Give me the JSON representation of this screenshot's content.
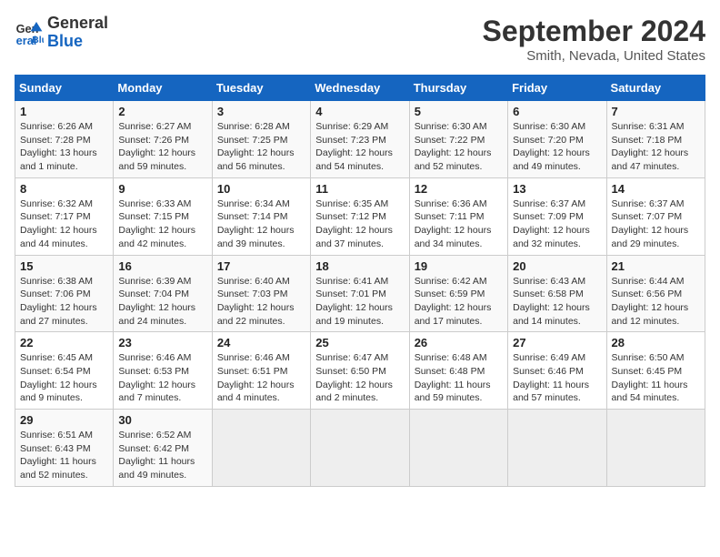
{
  "logo": {
    "line1": "General",
    "line2": "Blue"
  },
  "title": "September 2024",
  "subtitle": "Smith, Nevada, United States",
  "weekdays": [
    "Sunday",
    "Monday",
    "Tuesday",
    "Wednesday",
    "Thursday",
    "Friday",
    "Saturday"
  ],
  "weeks": [
    [
      {
        "day": "1",
        "info": "Sunrise: 6:26 AM\nSunset: 7:28 PM\nDaylight: 13 hours\nand 1 minute."
      },
      {
        "day": "2",
        "info": "Sunrise: 6:27 AM\nSunset: 7:26 PM\nDaylight: 12 hours\nand 59 minutes."
      },
      {
        "day": "3",
        "info": "Sunrise: 6:28 AM\nSunset: 7:25 PM\nDaylight: 12 hours\nand 56 minutes."
      },
      {
        "day": "4",
        "info": "Sunrise: 6:29 AM\nSunset: 7:23 PM\nDaylight: 12 hours\nand 54 minutes."
      },
      {
        "day": "5",
        "info": "Sunrise: 6:30 AM\nSunset: 7:22 PM\nDaylight: 12 hours\nand 52 minutes."
      },
      {
        "day": "6",
        "info": "Sunrise: 6:30 AM\nSunset: 7:20 PM\nDaylight: 12 hours\nand 49 minutes."
      },
      {
        "day": "7",
        "info": "Sunrise: 6:31 AM\nSunset: 7:18 PM\nDaylight: 12 hours\nand 47 minutes."
      }
    ],
    [
      {
        "day": "8",
        "info": "Sunrise: 6:32 AM\nSunset: 7:17 PM\nDaylight: 12 hours\nand 44 minutes."
      },
      {
        "day": "9",
        "info": "Sunrise: 6:33 AM\nSunset: 7:15 PM\nDaylight: 12 hours\nand 42 minutes."
      },
      {
        "day": "10",
        "info": "Sunrise: 6:34 AM\nSunset: 7:14 PM\nDaylight: 12 hours\nand 39 minutes."
      },
      {
        "day": "11",
        "info": "Sunrise: 6:35 AM\nSunset: 7:12 PM\nDaylight: 12 hours\nand 37 minutes."
      },
      {
        "day": "12",
        "info": "Sunrise: 6:36 AM\nSunset: 7:11 PM\nDaylight: 12 hours\nand 34 minutes."
      },
      {
        "day": "13",
        "info": "Sunrise: 6:37 AM\nSunset: 7:09 PM\nDaylight: 12 hours\nand 32 minutes."
      },
      {
        "day": "14",
        "info": "Sunrise: 6:37 AM\nSunset: 7:07 PM\nDaylight: 12 hours\nand 29 minutes."
      }
    ],
    [
      {
        "day": "15",
        "info": "Sunrise: 6:38 AM\nSunset: 7:06 PM\nDaylight: 12 hours\nand 27 minutes."
      },
      {
        "day": "16",
        "info": "Sunrise: 6:39 AM\nSunset: 7:04 PM\nDaylight: 12 hours\nand 24 minutes."
      },
      {
        "day": "17",
        "info": "Sunrise: 6:40 AM\nSunset: 7:03 PM\nDaylight: 12 hours\nand 22 minutes."
      },
      {
        "day": "18",
        "info": "Sunrise: 6:41 AM\nSunset: 7:01 PM\nDaylight: 12 hours\nand 19 minutes."
      },
      {
        "day": "19",
        "info": "Sunrise: 6:42 AM\nSunset: 6:59 PM\nDaylight: 12 hours\nand 17 minutes."
      },
      {
        "day": "20",
        "info": "Sunrise: 6:43 AM\nSunset: 6:58 PM\nDaylight: 12 hours\nand 14 minutes."
      },
      {
        "day": "21",
        "info": "Sunrise: 6:44 AM\nSunset: 6:56 PM\nDaylight: 12 hours\nand 12 minutes."
      }
    ],
    [
      {
        "day": "22",
        "info": "Sunrise: 6:45 AM\nSunset: 6:54 PM\nDaylight: 12 hours\nand 9 minutes."
      },
      {
        "day": "23",
        "info": "Sunrise: 6:46 AM\nSunset: 6:53 PM\nDaylight: 12 hours\nand 7 minutes."
      },
      {
        "day": "24",
        "info": "Sunrise: 6:46 AM\nSunset: 6:51 PM\nDaylight: 12 hours\nand 4 minutes."
      },
      {
        "day": "25",
        "info": "Sunrise: 6:47 AM\nSunset: 6:50 PM\nDaylight: 12 hours\nand 2 minutes."
      },
      {
        "day": "26",
        "info": "Sunrise: 6:48 AM\nSunset: 6:48 PM\nDaylight: 11 hours\nand 59 minutes."
      },
      {
        "day": "27",
        "info": "Sunrise: 6:49 AM\nSunset: 6:46 PM\nDaylight: 11 hours\nand 57 minutes."
      },
      {
        "day": "28",
        "info": "Sunrise: 6:50 AM\nSunset: 6:45 PM\nDaylight: 11 hours\nand 54 minutes."
      }
    ],
    [
      {
        "day": "29",
        "info": "Sunrise: 6:51 AM\nSunset: 6:43 PM\nDaylight: 11 hours\nand 52 minutes."
      },
      {
        "day": "30",
        "info": "Sunrise: 6:52 AM\nSunset: 6:42 PM\nDaylight: 11 hours\nand 49 minutes."
      },
      {
        "day": "",
        "info": ""
      },
      {
        "day": "",
        "info": ""
      },
      {
        "day": "",
        "info": ""
      },
      {
        "day": "",
        "info": ""
      },
      {
        "day": "",
        "info": ""
      }
    ]
  ]
}
